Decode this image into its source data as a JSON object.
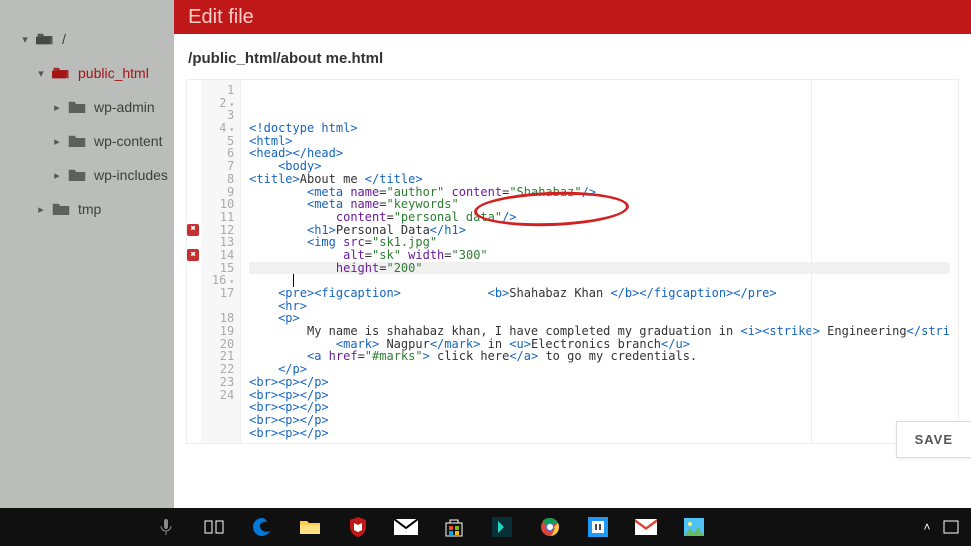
{
  "header": {
    "title": "Edit file"
  },
  "path": "/public_html/about me.html",
  "sidebar": {
    "root": "/",
    "items": [
      {
        "label": "public_html",
        "selected": true,
        "expanded": true,
        "children": [
          {
            "label": "wp-admin"
          },
          {
            "label": "wp-content"
          },
          {
            "label": "wp-includes"
          }
        ]
      },
      {
        "label": "tmp"
      }
    ]
  },
  "save_label": "SAVE",
  "code": {
    "lines": [
      {
        "n": 1,
        "html": "<span class='tag'>&lt;!doctype html&gt;</span>"
      },
      {
        "n": 2,
        "fold": "d",
        "html": "<span class='tag'>&lt;html&gt;</span>"
      },
      {
        "n": 3,
        "html": "<span class='tag'>&lt;head&gt;&lt;/head&gt;</span>"
      },
      {
        "n": 4,
        "fold": "d",
        "html": "    <span class='tag'>&lt;body&gt;</span>"
      },
      {
        "n": 5,
        "html": "<span class='tag'>&lt;title&gt;</span>About me <span class='tag'>&lt;/title&gt;</span>"
      },
      {
        "n": 6,
        "html": "        <span class='tag'>&lt;meta</span> <span class='attr'>name</span>=<span class='val'>\"author\"</span> <span class='attr'>content</span>=<span class='val'>\"Shahabaz\"</span><span class='tag'>/&gt;</span>"
      },
      {
        "n": 7,
        "html": "        <span class='tag'>&lt;meta</span> <span class='attr'>name</span>=<span class='val'>\"keywords\"</span>"
      },
      {
        "n": 8,
        "html": "            <span class='attr'>content</span>=<span class='val'>\"personal data\"</span><span class='tag'>/&gt;</span>"
      },
      {
        "n": 9,
        "html": "        <span class='tag'>&lt;h1&gt;</span>Personal Data<span class='tag'>&lt;/h1&gt;</span>"
      },
      {
        "n": 10,
        "html": "        <span class='tag'>&lt;img</span> <span class='attr'>src</span>=<span class='val'>\"sk1.jpg\"</span>"
      },
      {
        "n": 11,
        "html": "             <span class='attr'>alt</span>=<span class='val'>\"sk\"</span> <span class='attr'>width</span>=<span class='val'>\"300\"</span>"
      },
      {
        "n": 12,
        "err": true,
        "hl": true,
        "html": "            <span class='attr'>height</span>=<span class='val'>\"200\"</span>"
      },
      {
        "n": 13,
        "cursor": true,
        "html": ""
      },
      {
        "n": 14,
        "err": true,
        "html": "    <span class='tag'>&lt;pre&gt;&lt;figcaption&gt;</span>            <span class='tag'>&lt;b&gt;</span>Shahabaz Khan <span class='tag'>&lt;/b&gt;&lt;/figcaption&gt;&lt;/pre&gt;</span>"
      },
      {
        "n": 15,
        "html": "    <span class='tag'>&lt;hr&gt;</span>"
      },
      {
        "n": 16,
        "fold": "d",
        "html": "    <span class='tag'>&lt;p&gt;</span>"
      },
      {
        "n": 17,
        "html": "        My name is shahabaz khan, I have completed my graduation in <span class='tag'>&lt;i&gt;&lt;strike&gt;</span> Engineering<span class='tag'>&lt;/stri</span>\n            <span class='tag'>&lt;mark&gt;</span> Nagpur<span class='tag'>&lt;/mark&gt;</span> in <span class='tag'>&lt;u&gt;</span>Electronics branch<span class='tag'>&lt;/u&gt;</span>"
      },
      {
        "n": 18,
        "html": "        <span class='tag'>&lt;a</span> <span class='attr'>href</span>=<span class='val'>\"#marks\"</span><span class='tag'>&gt;</span> click here<span class='tag'>&lt;/a&gt;</span> to go my credentials."
      },
      {
        "n": 19,
        "html": "    <span class='tag'>&lt;/p&gt;</span>"
      },
      {
        "n": 20,
        "html": "<span class='tag'>&lt;br&gt;&lt;p&gt;&lt;/p&gt;</span>"
      },
      {
        "n": 21,
        "html": "<span class='tag'>&lt;br&gt;&lt;p&gt;&lt;/p&gt;</span>"
      },
      {
        "n": 22,
        "html": "<span class='tag'>&lt;br&gt;&lt;p&gt;&lt;/p&gt;</span>"
      },
      {
        "n": 23,
        "html": "<span class='tag'>&lt;br&gt;&lt;p&gt;&lt;/p&gt;</span>"
      },
      {
        "n": 24,
        "html": "<span class='tag'>&lt;br&gt;&lt;p&gt;&lt;/p&gt;</span>"
      }
    ]
  },
  "annotation": {
    "target": "img src=\"sk1.jpg\""
  },
  "taskbar": {
    "icons": [
      "cortana",
      "task-view",
      "edge",
      "file-explorer",
      "mcafee",
      "mail",
      "store",
      "filmora",
      "chrome",
      "brackets",
      "gmail",
      "photos"
    ]
  }
}
